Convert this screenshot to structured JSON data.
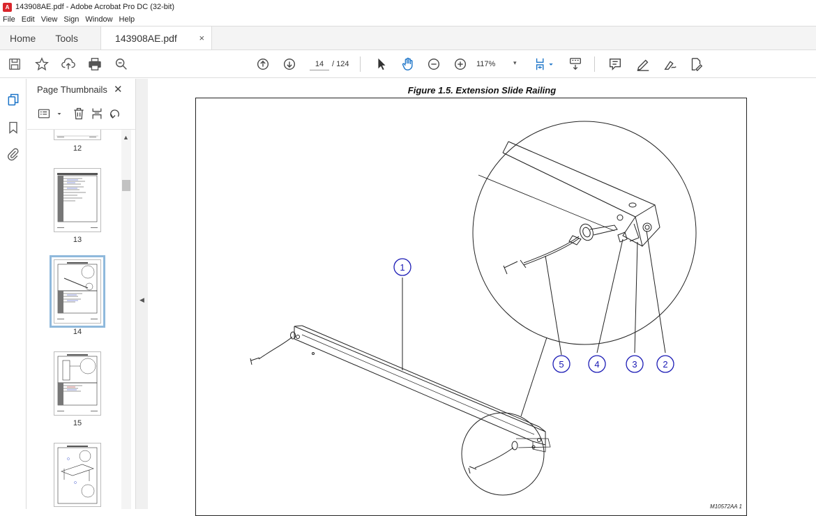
{
  "window": {
    "title": "143908AE.pdf - Adobe Acrobat Pro DC (32-bit)",
    "logo_text": "A"
  },
  "menu": [
    "File",
    "Edit",
    "View",
    "Sign",
    "Window",
    "Help"
  ],
  "tabs": {
    "home": "Home",
    "tools": "Tools",
    "document": "143908AE.pdf",
    "close": "×"
  },
  "toolbar": {
    "current_page": "14",
    "page_total": "/ 124",
    "zoom": "117%",
    "zoom_caret": "▾"
  },
  "thumbnails": {
    "panel_title": "Page Thumbnails",
    "close": "✕",
    "pages": [
      {
        "label": "12"
      },
      {
        "label": "13"
      },
      {
        "label": "14",
        "selected": true
      },
      {
        "label": "15"
      },
      {
        "label": ""
      }
    ]
  },
  "document": {
    "figure_title": "Figure 1.5.  Extension Slide Railing",
    "figure_code": "M10572AA  1",
    "callouts": [
      "1",
      "5",
      "4",
      "3",
      "2"
    ]
  },
  "colors": {
    "callout": "#1b1bb5",
    "selection": "#8fb9dc",
    "pdf_red": "#d9262c"
  }
}
